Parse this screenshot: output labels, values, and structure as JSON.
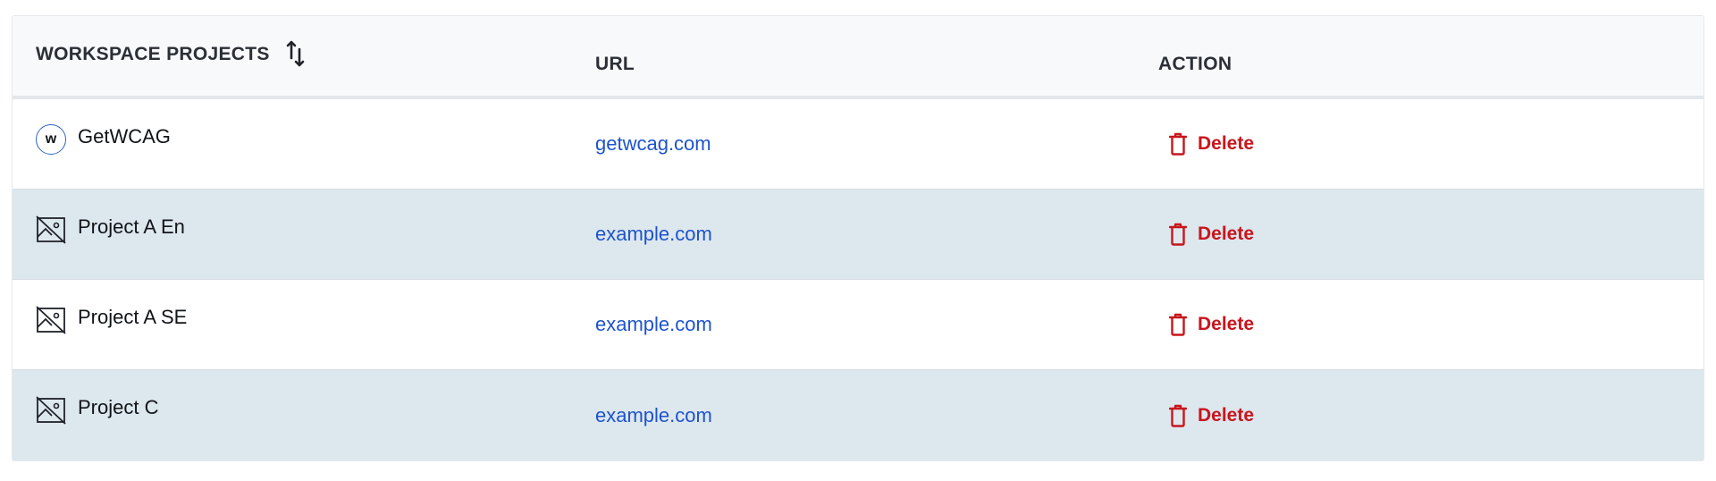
{
  "table": {
    "headers": {
      "name": "WORKSPACE PROJECTS",
      "url": "URL",
      "action": "ACTION"
    },
    "rows": [
      {
        "name": "GetWCAG",
        "icon": "w-logo-icon",
        "avatar_letter": "w",
        "url": "getwcag.com",
        "action": "Delete"
      },
      {
        "name": "Project A En",
        "icon": "broken-image-icon",
        "url": "example.com",
        "action": "Delete"
      },
      {
        "name": "Project A SE",
        "icon": "broken-image-icon",
        "url": "example.com",
        "action": "Delete"
      },
      {
        "name": "Project C",
        "icon": "broken-image-icon",
        "url": "example.com",
        "action": "Delete"
      }
    ]
  },
  "colors": {
    "header_bg": "#f8f9fb",
    "alt_row_bg": "#dde7ee",
    "link": "#1d54cc",
    "danger": "#c8161d"
  }
}
